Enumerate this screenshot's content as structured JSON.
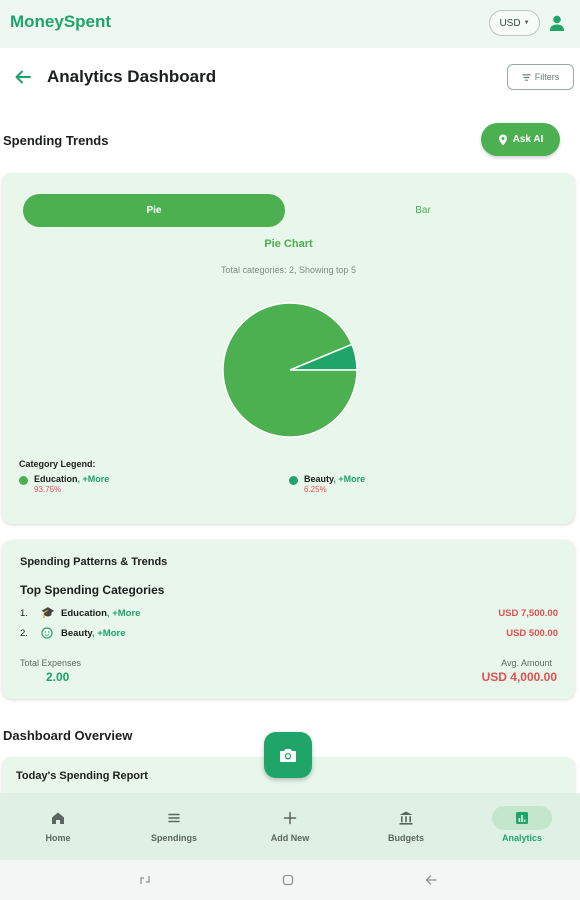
{
  "app": {
    "brand": "MoneySpent",
    "currency": "USD"
  },
  "header": {
    "title": "Analytics Dashboard",
    "filters_label": "Filters"
  },
  "spending_trends": {
    "title": "Spending Trends",
    "ask_ai_label": "Ask AI",
    "toggle": {
      "pie_label": "Pie",
      "bar_label": "Bar",
      "selected": "Pie"
    },
    "chart_title": "Pie Chart",
    "chart_subtitle": "Total categories: 2, Showing top 5",
    "legend_title": "Category Legend:",
    "legend": [
      {
        "name": "Education",
        "more": ", +More",
        "percent": "93.75%",
        "color": "#4caf50"
      },
      {
        "name": "Beauty",
        "more": ", +More",
        "percent": "6.25%",
        "color": "#1fa46a"
      }
    ]
  },
  "chart_data": {
    "type": "pie",
    "title": "Pie Chart",
    "subtitle": "Total categories: 2, Showing top 5",
    "categories": [
      "Education",
      "Beauty"
    ],
    "values": [
      93.75,
      6.25
    ],
    "colors": [
      "#4caf50",
      "#1fa46a"
    ],
    "legend_position": "bottom"
  },
  "patterns": {
    "title": "Spending Patterns & Trends",
    "subtitle": "Top Spending Categories",
    "categories": [
      {
        "num": "1.",
        "icon": "graduation-cap-icon",
        "name": "Education",
        "more": ", +More",
        "amount": "USD 7,500.00"
      },
      {
        "num": "2.",
        "icon": "face-icon",
        "name": "Beauty",
        "more": ", +More",
        "amount": "USD 500.00"
      }
    ],
    "total_label": "Total Expenses",
    "total_value": "2.00",
    "avg_label": "Avg. Amount",
    "avg_value": "USD 4,000.00"
  },
  "overview": {
    "title": "Dashboard Overview",
    "report_title": "Today's Spending Report"
  },
  "nav": [
    {
      "label": "Home",
      "icon": "home-icon",
      "active": false
    },
    {
      "label": "Spendings",
      "icon": "list-icon",
      "active": false
    },
    {
      "label": "Add New",
      "icon": "plus-icon",
      "active": false
    },
    {
      "label": "Budgets",
      "icon": "bank-icon",
      "active": false
    },
    {
      "label": "Analytics",
      "icon": "analytics-icon",
      "active": true
    }
  ],
  "colors": {
    "primary": "#4caf50",
    "accent": "#1fa46a",
    "negative": "#e05050",
    "card_bg": "#e8f6ec"
  }
}
